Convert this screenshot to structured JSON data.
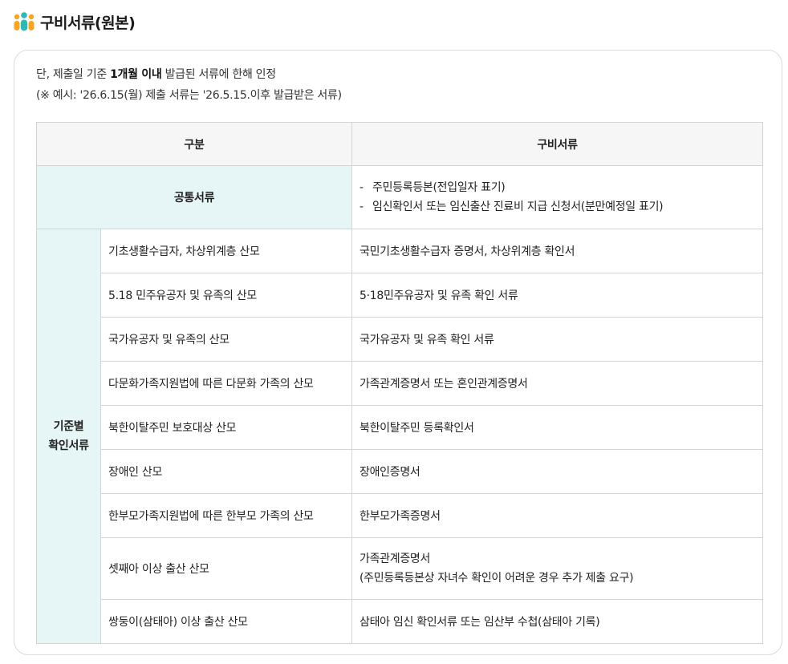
{
  "heading": {
    "title": "구비서류(원본)",
    "icon": "people-icon",
    "icon_colors": [
      "#f5a623",
      "#2db9b4",
      "#f5a623"
    ]
  },
  "notice": {
    "line1_prefix": "단, 제출일 기준 ",
    "line1_bold": "1개월 이내",
    "line1_suffix": " 발급된 서류에 한해 인정",
    "line2": "(※ 예시: '26.6.15(월) 제출 서류는 '26.5.15.이후 발급받은 서류)"
  },
  "table": {
    "headers": [
      "구분",
      "구비서류"
    ],
    "common": {
      "category": "공통서류",
      "documents": [
        "주민등록등본(전입일자 표기)",
        "임신확인서 또는 임신출산 진료비 지급 신청서(분만예정일 표기)"
      ]
    },
    "group": {
      "category_line1": "기준별",
      "category_line2": "확인서류",
      "rows": [
        {
          "criteria": "기초생활수급자, 차상위계층 산모",
          "document": "국민기초생활수급자 증명서, 차상위계층 확인서"
        },
        {
          "criteria": "5.18 민주유공자 및 유족의 산모",
          "document": "5·18민주유공자 및 유족 확인 서류"
        },
        {
          "criteria": "국가유공자 및 유족의 산모",
          "document": "국가유공자 및 유족 확인 서류"
        },
        {
          "criteria": "다문화가족지원법에 따른 다문화 가족의 산모",
          "document": "가족관계증명서 또는 혼인관계증명서"
        },
        {
          "criteria": "북한이탈주민 보호대상 산모",
          "document": "북한이탈주민 등록확인서"
        },
        {
          "criteria": "장애인 산모",
          "document": "장애인증명서"
        },
        {
          "criteria": "한부모가족지원법에 따른 한부모 가족의 산모",
          "document": "한부모가족증명서"
        },
        {
          "criteria": "셋째아 이상 출산 산모",
          "document": "가족관계증명서",
          "document_line2": "(주민등록등본상 자녀수 확인이 어려운 경우 추가 제출 요구)"
        },
        {
          "criteria": "쌍둥이(삼태아) 이상 출산 산모",
          "document": "삼태아 임신 확인서류 또는 임산부 수첩(삼태아 기록)"
        }
      ]
    }
  }
}
